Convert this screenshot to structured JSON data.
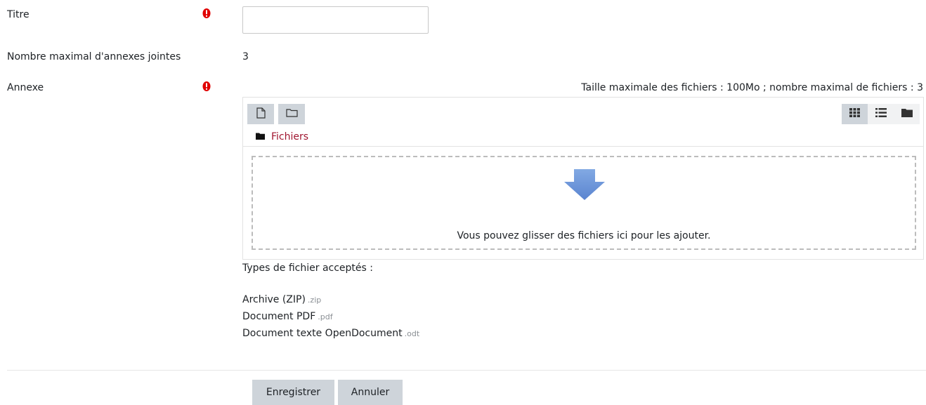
{
  "form": {
    "title_label": "Titre",
    "title_value": "",
    "max_attachments_label": "Nombre maximal d'annexes jointes",
    "max_attachments_value": "3",
    "attachment_label": "Annexe"
  },
  "filepicker": {
    "limits_text": "Taille maximale des fichiers : 100Mo ; nombre maximal de fichiers : 3",
    "path_label": "Fichiers",
    "dropzone_text": "Vous pouvez glisser des fichiers ici pour les ajouter.",
    "toolbar_icons": [
      "add-file-icon",
      "create-folder-icon"
    ],
    "view_icons": [
      "grid-view-icon",
      "list-view-icon",
      "tree-view-icon"
    ],
    "active_view": "grid"
  },
  "accepted_types": {
    "title": "Types de fichier acceptés :",
    "items": [
      {
        "name": "Archive (ZIP)",
        "ext": ".zip"
      },
      {
        "name": "Document PDF",
        "ext": ".pdf"
      },
      {
        "name": "Document texte OpenDocument",
        "ext": ".odt"
      }
    ]
  },
  "actions": {
    "save_label": "Enregistrer",
    "cancel_label": "Annuler"
  },
  "colors": {
    "required_icon": "#e00000",
    "link": "#a0152f",
    "button_bg": "#ced4da",
    "dropzone_arrow": "#6a92d6"
  }
}
